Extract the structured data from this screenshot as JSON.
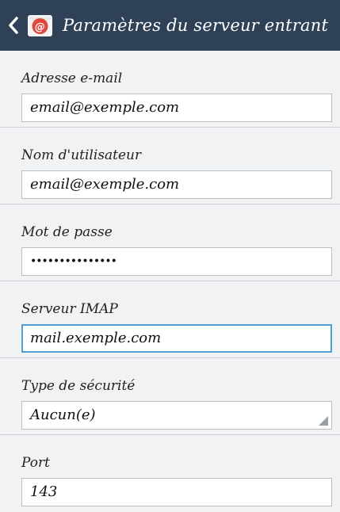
{
  "header": {
    "title": "Paramètres du serveur entrant",
    "back_icon": "chevron-left-icon",
    "app_icon": "email-app-icon",
    "colors": {
      "bar": "#2f4156",
      "icon_red": "#e0463c"
    }
  },
  "form": {
    "email": {
      "label": "Adresse e-mail",
      "value": "email@exemple.com"
    },
    "username": {
      "label": "Nom d'utilisateur",
      "value": "email@exemple.com"
    },
    "password": {
      "label": "Mot de passe",
      "value": "•••••••••••••••"
    },
    "server": {
      "label": "Serveur IMAP",
      "value": "mail.exemple.com"
    },
    "security": {
      "label": "Type de sécurité",
      "value": "Aucun(e)"
    },
    "port": {
      "label": "Port",
      "value": "143"
    }
  }
}
